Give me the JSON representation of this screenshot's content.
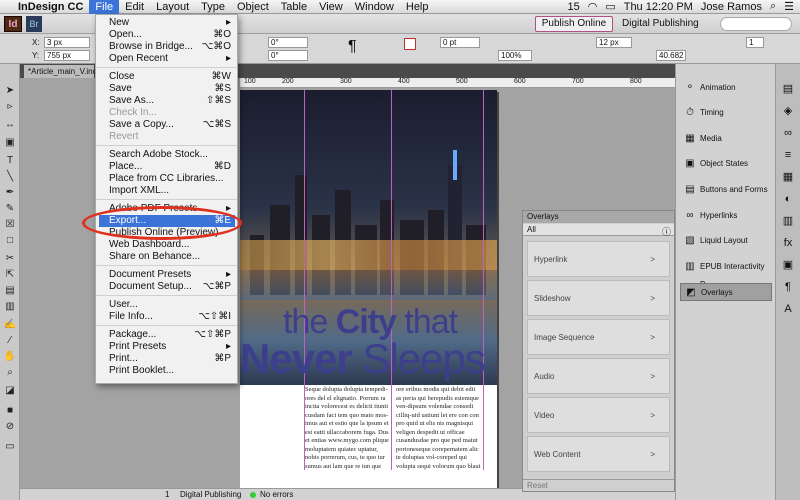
{
  "menubar": {
    "apple": "",
    "app_name": "InDesign CC",
    "items": [
      "File",
      "Edit",
      "Layout",
      "Type",
      "Object",
      "Table",
      "View",
      "Window",
      "Help"
    ],
    "status_number": "15",
    "clock": "Thu 12:20 PM",
    "user": "Jose Ramos"
  },
  "appbar": {
    "logo": "Id",
    "bridge": "Br",
    "publish_online": "Publish Online",
    "workspace": "Digital Publishing"
  },
  "controlbar": {
    "x_label": "X:",
    "x_value": "3 px",
    "y_label": "Y:",
    "y_value": "755 px",
    "rotate": "0°",
    "shear": "0°",
    "stroke": "0 pt",
    "scale": "100%",
    "size1": "12 px",
    "size2": "40.682",
    "num": "1"
  },
  "document": {
    "tab": "*Article_main_V.ind",
    "ruler": [
      "200",
      "100",
      "200",
      "300",
      "400",
      "500",
      "600",
      "700",
      "800"
    ],
    "headline1_light": "the ",
    "headline1_bold": "City",
    "headline1_tail": " that",
    "headline2_bold": "Never",
    "headline2_light": " Sleeps",
    "col1": "Seque dolupta dolupta tempedi-ores del el elignatio. Porrum ra incita volorecest es delicti tiunti cusdam faci tem quo mato mos-imus aut et estio que la ipsum et est eatti ullaccaborem fuga. Dus et entias www.mygo.com plique moluptatem quiatec uptatur, nobis porrerum, cus, te quo iur sumus aut lam que re iun que maior aut volupta speditate nonsed que volo",
    "col2": "ore eribus modis qui debit edit as peria qui berepudis estemque ven-dipsum volendae consedi cilliq-uid ustiunt let ere con con pro quid ut elis nis magnisqui veligen despedit ut officae cusandusdae pro que ped maiut porioneseque corepernatem alic te doluptas vol-coreped qui volupta sequi volorum quo blaut estrachium doloreprer volorem disciae nonsequodi audi-"
  },
  "file_menu": {
    "groups": [
      [
        {
          "label": "New",
          "shortcut": "▸"
        },
        {
          "label": "Open...",
          "shortcut": "⌘O"
        },
        {
          "label": "Browse in Bridge...",
          "shortcut": "⌥⌘O"
        },
        {
          "label": "Open Recent",
          "shortcut": "▸"
        }
      ],
      [
        {
          "label": "Close",
          "shortcut": "⌘W"
        },
        {
          "label": "Save",
          "shortcut": "⌘S"
        },
        {
          "label": "Save As...",
          "shortcut": "⇧⌘S"
        },
        {
          "label": "Check In...",
          "shortcut": ""
        },
        {
          "label": "Save a Copy...",
          "shortcut": "⌥⌘S"
        },
        {
          "label": "Revert",
          "shortcut": ""
        }
      ],
      [
        {
          "label": "Search Adobe Stock...",
          "shortcut": ""
        },
        {
          "label": "Place...",
          "shortcut": "⌘D"
        },
        {
          "label": "Place from CC Libraries...",
          "shortcut": ""
        },
        {
          "label": "Import XML...",
          "shortcut": ""
        }
      ],
      [
        {
          "label": "Adobe PDF Presets",
          "shortcut": "▸"
        },
        {
          "label": "Export...",
          "shortcut": "⌘E"
        },
        {
          "label": "Publish Online (Preview)",
          "shortcut": ""
        },
        {
          "label": "Web Dashboard...",
          "shortcut": ""
        },
        {
          "label": "Share on Behance...",
          "shortcut": ""
        }
      ],
      [
        {
          "label": "Document Presets",
          "shortcut": "▸"
        },
        {
          "label": "Document Setup...",
          "shortcut": "⌥⌘P"
        }
      ],
      [
        {
          "label": "User...",
          "shortcut": ""
        },
        {
          "label": "File Info...",
          "shortcut": "⌥⇧⌘I"
        }
      ],
      [
        {
          "label": "Package...",
          "shortcut": "⌥⇧⌘P"
        },
        {
          "label": "Print Presets",
          "shortcut": "▸"
        },
        {
          "label": "Print...",
          "shortcut": "⌘P"
        },
        {
          "label": "Print Booklet...",
          "shortcut": ""
        }
      ]
    ]
  },
  "overlays": {
    "title": "Overlays",
    "filter": "All",
    "items": [
      "Hyperlink",
      "Slideshow",
      "Image Sequence",
      "Audio",
      "Video",
      "Web Content"
    ],
    "footer": "Reset"
  },
  "right_panels": [
    "Animation",
    "Timing",
    "Media",
    "Object States",
    "Buttons and Forms",
    "Hyperlinks",
    "Liquid Layout",
    "EPUB Interactivity P...",
    "Overlays"
  ],
  "statusbar": {
    "page": "1",
    "preset": "Digital Publishing",
    "errors": "No errors"
  },
  "colors": {
    "accent": "#3b73d8",
    "headline": "#3e3f8c",
    "highlight_ring": "#e0301e"
  }
}
